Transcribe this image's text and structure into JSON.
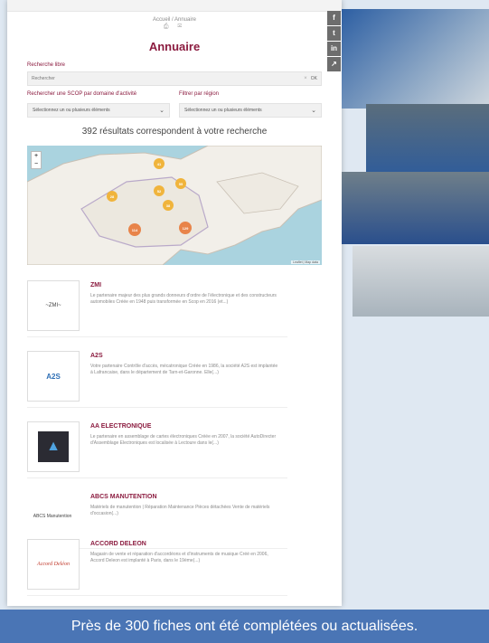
{
  "breadcrumb": "Accueil / Annuaire",
  "print_icons": "⎙ ✉",
  "page_title": "Annuaire",
  "search": {
    "label": "Recherche libre",
    "placeholder": "Rechercher",
    "ok_label": "OK",
    "clear_icon": "×"
  },
  "filters": [
    {
      "label": "Rechercher une SCOP par domaine d'activité",
      "value": "Sélectionnez un ou plusieurs éléments"
    },
    {
      "label": "Filtrer par région",
      "value": "Sélectionnez un ou plusieurs éléments"
    }
  ],
  "results_text": "392 résultats correspondent à votre recherche",
  "map": {
    "zoom_in": "+",
    "zoom_out": "−",
    "attribution": "Leaflet | Map data",
    "clusters": [
      "41",
      "52",
      "28",
      "55",
      "38",
      "114",
      "129"
    ]
  },
  "entries": [
    {
      "name": "ZMI",
      "logo_text": "~ZMI~",
      "desc": "Le partenaire majeur des plus grands donneurs d'ordre de l'électronique et des constructeurs automobiles Créée en 1948 puis transformée en Scop en 2016 (et...)"
    },
    {
      "name": "A2S",
      "logo_text": "A2S",
      "desc": "Votre partenaire Contrôle d'accès, mécatronique Créée en 1986, la société A2S est implantée à Lafrancaise, dans le département de Tarn-et-Garonne. Elle(...)"
    },
    {
      "name": "AA ELECTRONIQUE",
      "logo_text": "▲",
      "desc": "Le partenaire en assemblage de cartes électroniques Créée en 2007, la société AutoDirecter d'Assemblage Electroniques est localisée à Lectoure dans le(...)"
    },
    {
      "name": "ABCS MANUTENTION",
      "logo_text": "ABCS Manutention",
      "desc": "Matériels de manutention | Réparation Maintenance Pièces détachées Vente de matériels d'occasion(...)"
    },
    {
      "name": "ACCORD DELEON",
      "logo_text": "Accord Deléon",
      "desc": "Magasin de vente et réparation d'accordéons et d'instruments de musique Créé en 2006, Accord Deleon est implanté à Paris, dans le 19ème(...)"
    }
  ],
  "social": [
    "f",
    "t",
    "in",
    "↗"
  ],
  "caption": "Près de 300 fiches ont été complétées ou actualisées."
}
